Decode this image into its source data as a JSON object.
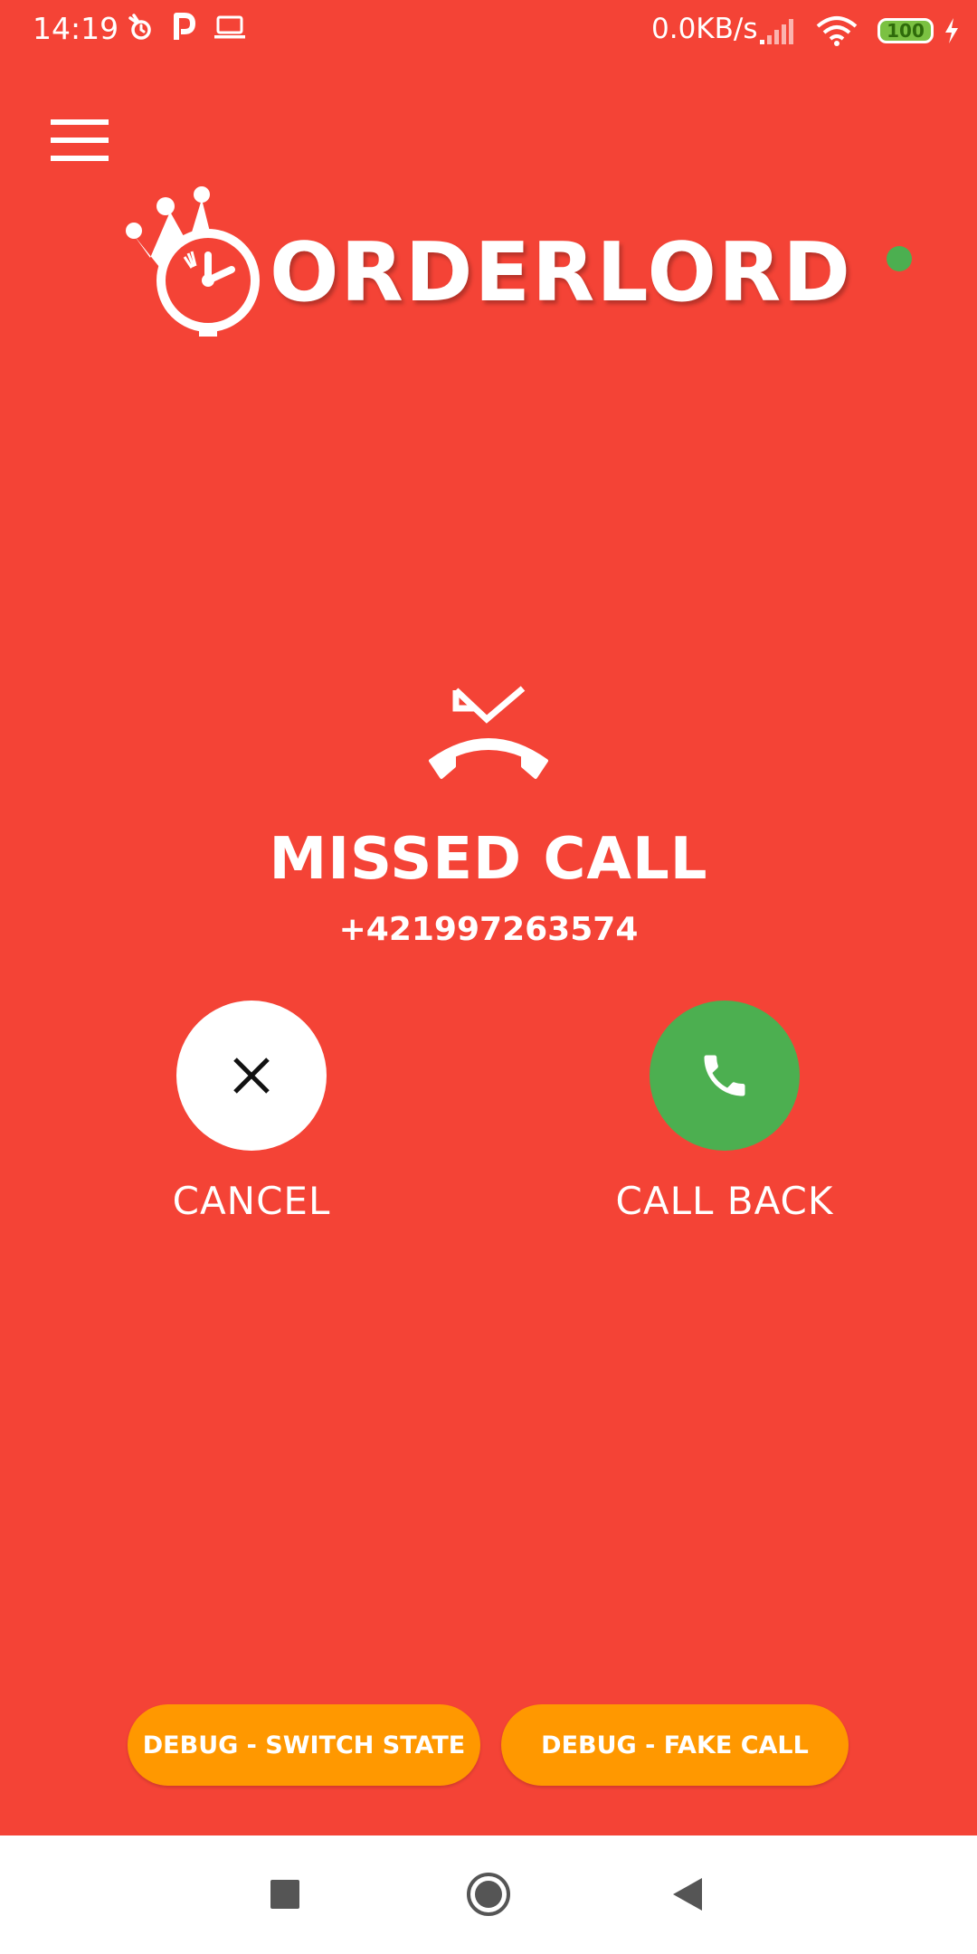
{
  "status_bar": {
    "time": "14:19",
    "net_speed": "0.0KB/s",
    "battery_level": "100",
    "icons": [
      "alarm-icon",
      "parking-p-icon",
      "laptop-icon",
      "signal-icon",
      "wifi-icon",
      "battery-icon",
      "charging-icon"
    ]
  },
  "header": {
    "logo_text": "ORDERLORD",
    "connection_status_color": "#4CAF50"
  },
  "call": {
    "title": "MISSED CALL",
    "number": "+421997263574"
  },
  "actions": {
    "cancel_label": "CANCEL",
    "callback_label": "CALL BACK"
  },
  "debug": {
    "switch_state_label": "DEBUG - SWITCH STATE",
    "fake_call_label": "DEBUG - FAKE CALL"
  },
  "colors": {
    "background": "#F44336",
    "callback": "#4CAF50",
    "debug_button": "#FF9800"
  }
}
